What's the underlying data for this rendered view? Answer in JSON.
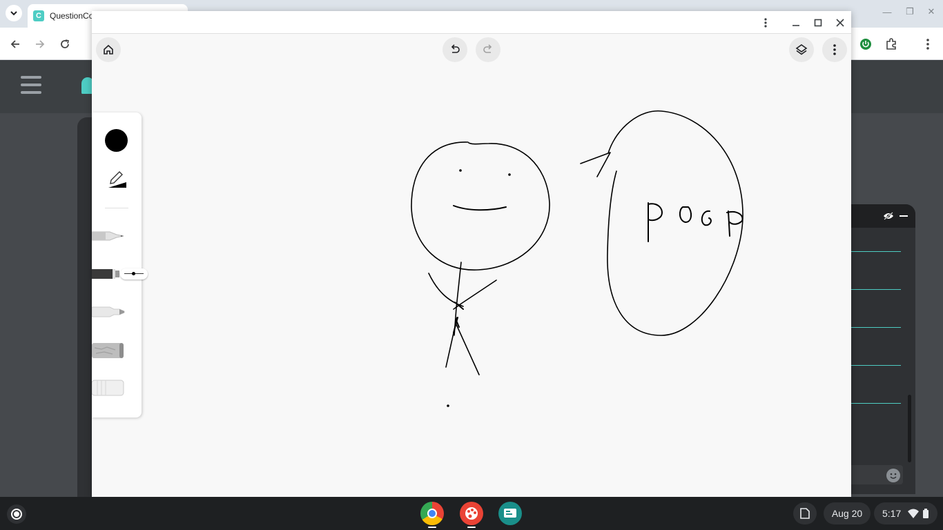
{
  "browser": {
    "tab_title": "QuestionCo",
    "tab_favicon_letter": "C"
  },
  "app": {
    "canvas_text": "POGP",
    "icons": [
      "home-icon",
      "undo-icon",
      "redo-icon",
      "layers-icon",
      "more-vert-icon",
      "minimize-icon",
      "maximize-icon",
      "close-icon"
    ],
    "tools": [
      "pencil",
      "fountain-pen",
      "marker",
      "chalk",
      "eraser"
    ],
    "selected_color": "#000000"
  },
  "shelf": {
    "date": "Aug 20",
    "time": "5:17"
  },
  "colors": {
    "accent": "#4ecdc4",
    "shelf": "#1e2022"
  }
}
